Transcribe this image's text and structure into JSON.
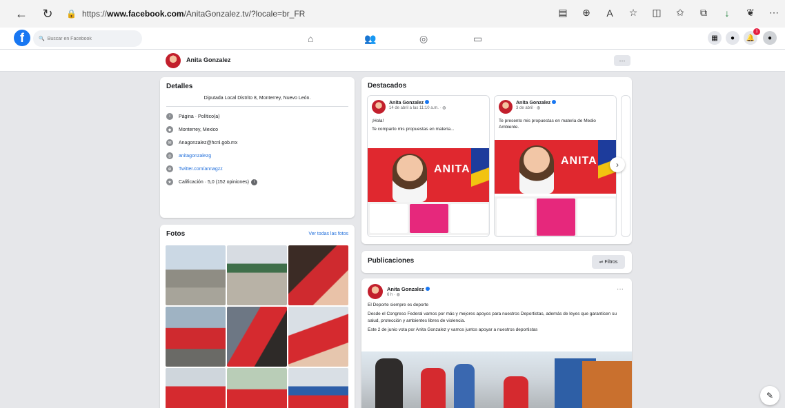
{
  "browser": {
    "url_prefix": "https://",
    "url_domain": "www.facebook.com",
    "url_path": "/AnitaGonzalez.tv/?locale=br_FR",
    "icons": [
      "back-icon",
      "refresh-icon",
      "lock-icon",
      "reader-icon",
      "zoom-icon",
      "read-aloud-icon",
      "favorite-icon",
      "split-icon",
      "favorites-icon",
      "collections-icon",
      "downloads-icon",
      "extensions-icon",
      "more-icon"
    ]
  },
  "fb": {
    "logo": "f",
    "search_placeholder": "Buscar en Facebook",
    "notifications_count": "1"
  },
  "page": {
    "name": "Anita Gonzalez",
    "more_label": "···"
  },
  "details": {
    "title": "Detalles",
    "bio": "Diputada Local Distrito 8, Monterrey, Nuevo León.",
    "rows": [
      {
        "icon": "info-icon",
        "text": "Página · Político(a)"
      },
      {
        "icon": "location-icon",
        "text": "Monterrey, Mexico"
      },
      {
        "icon": "email-icon",
        "text": "Anagonzalez@hcnl.gob.mx"
      },
      {
        "icon": "instagram-icon",
        "text": "anitagonzalezg"
      },
      {
        "icon": "web-icon",
        "text": "Twitter.com/annagzz"
      },
      {
        "icon": "rating-icon",
        "text": "Calificación · 5,0 (152 opiniones)"
      }
    ]
  },
  "photos": {
    "title": "Fotos",
    "see_all": "Ver todas las fotos"
  },
  "featured": {
    "title": "Destacados",
    "cards": [
      {
        "name": "Anita Gonzalez",
        "time": "14 de abril a las 11:10 a.m. · ",
        "line1": "¡Hola!",
        "line2": "Te comparto mis propuestas en materia...",
        "brand": "ANITA"
      },
      {
        "name": "Anita Gonzalez",
        "time": "3 de abril · ",
        "line1": "Te presento mis propuestas en materia de Medio Ambiente.",
        "line2": "",
        "brand": "ANITA"
      }
    ]
  },
  "publications": {
    "title": "Publicaciones",
    "filter": "Filtros"
  },
  "post": {
    "name": "Anita Gonzalez",
    "time": "6 h · ",
    "line1": "El Deporte siempre es deporte",
    "line2": "Desde el Congreso Federal vamos por más y mejores apoyos para nuestros Deportistas, además de leyes que garanticen su salud, protección y ambientes libres de violencia.",
    "line3": "Este 2 de junio vota por Anita Gonzalez y vamos juntos apoyar a nuestros deportistas"
  },
  "colors": {
    "fb_blue": "#1877f2",
    "brand_red": "#e0282f",
    "link_blue": "#216fdb"
  }
}
